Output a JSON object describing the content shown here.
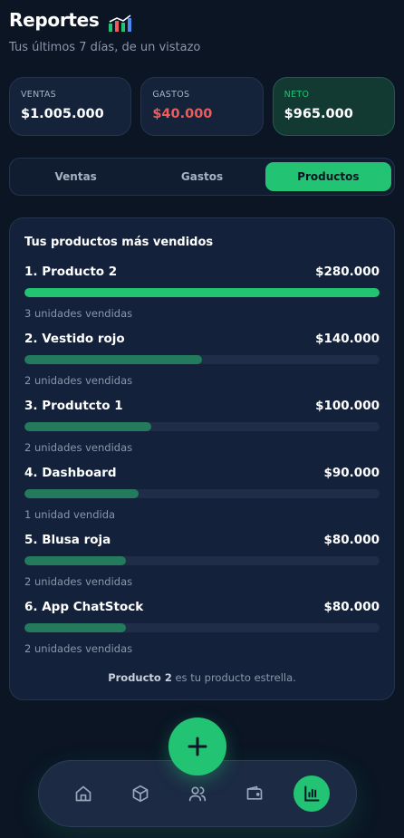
{
  "header": {
    "title": "Reportes",
    "subtitle": "Tus últimos 7 días, de un vistazo"
  },
  "stats": [
    {
      "label": "VENTAS",
      "value": "$1.005.000"
    },
    {
      "label": "GASTOS",
      "value": "$40.000"
    },
    {
      "label": "NETO",
      "value": "$965.000"
    }
  ],
  "tabs": [
    {
      "label": "Ventas"
    },
    {
      "label": "Gastos"
    },
    {
      "label": "Productos",
      "active": true
    }
  ],
  "card": {
    "title": "Tus productos más vendidos",
    "products": [
      {
        "name": "1. Producto 2",
        "amount": "$280.000",
        "units": "3 unidades vendidas",
        "fraction": 1.0
      },
      {
        "name": "2. Vestido rojo",
        "amount": "$140.000",
        "units": "2 unidades vendidas",
        "fraction": 0.5
      },
      {
        "name": "3. Produtcto 1",
        "amount": "$100.000",
        "units": "2 unidades vendidas",
        "fraction": 0.357
      },
      {
        "name": "4. Dashboard",
        "amount": "$90.000",
        "units": "1 unidad vendida",
        "fraction": 0.321
      },
      {
        "name": "5. Blusa roja",
        "amount": "$80.000",
        "units": "2 unidades vendidas",
        "fraction": 0.286
      },
      {
        "name": "6. App ChatStock",
        "amount": "$80.000",
        "units": "2 unidades vendidas",
        "fraction": 0.286
      }
    ],
    "star_product": "Producto 2",
    "star_suffix": " es tu producto estrella."
  },
  "colors": {
    "accent": "#22c473",
    "expense": "#ef5a5a",
    "bar_secondary": "#237a5c",
    "track": "#1f2d48"
  },
  "nav": [
    {
      "icon": "home-icon"
    },
    {
      "icon": "box-icon"
    },
    {
      "icon": "users-icon"
    },
    {
      "icon": "wallet-icon"
    },
    {
      "icon": "bar-chart-icon",
      "active": true
    }
  ]
}
